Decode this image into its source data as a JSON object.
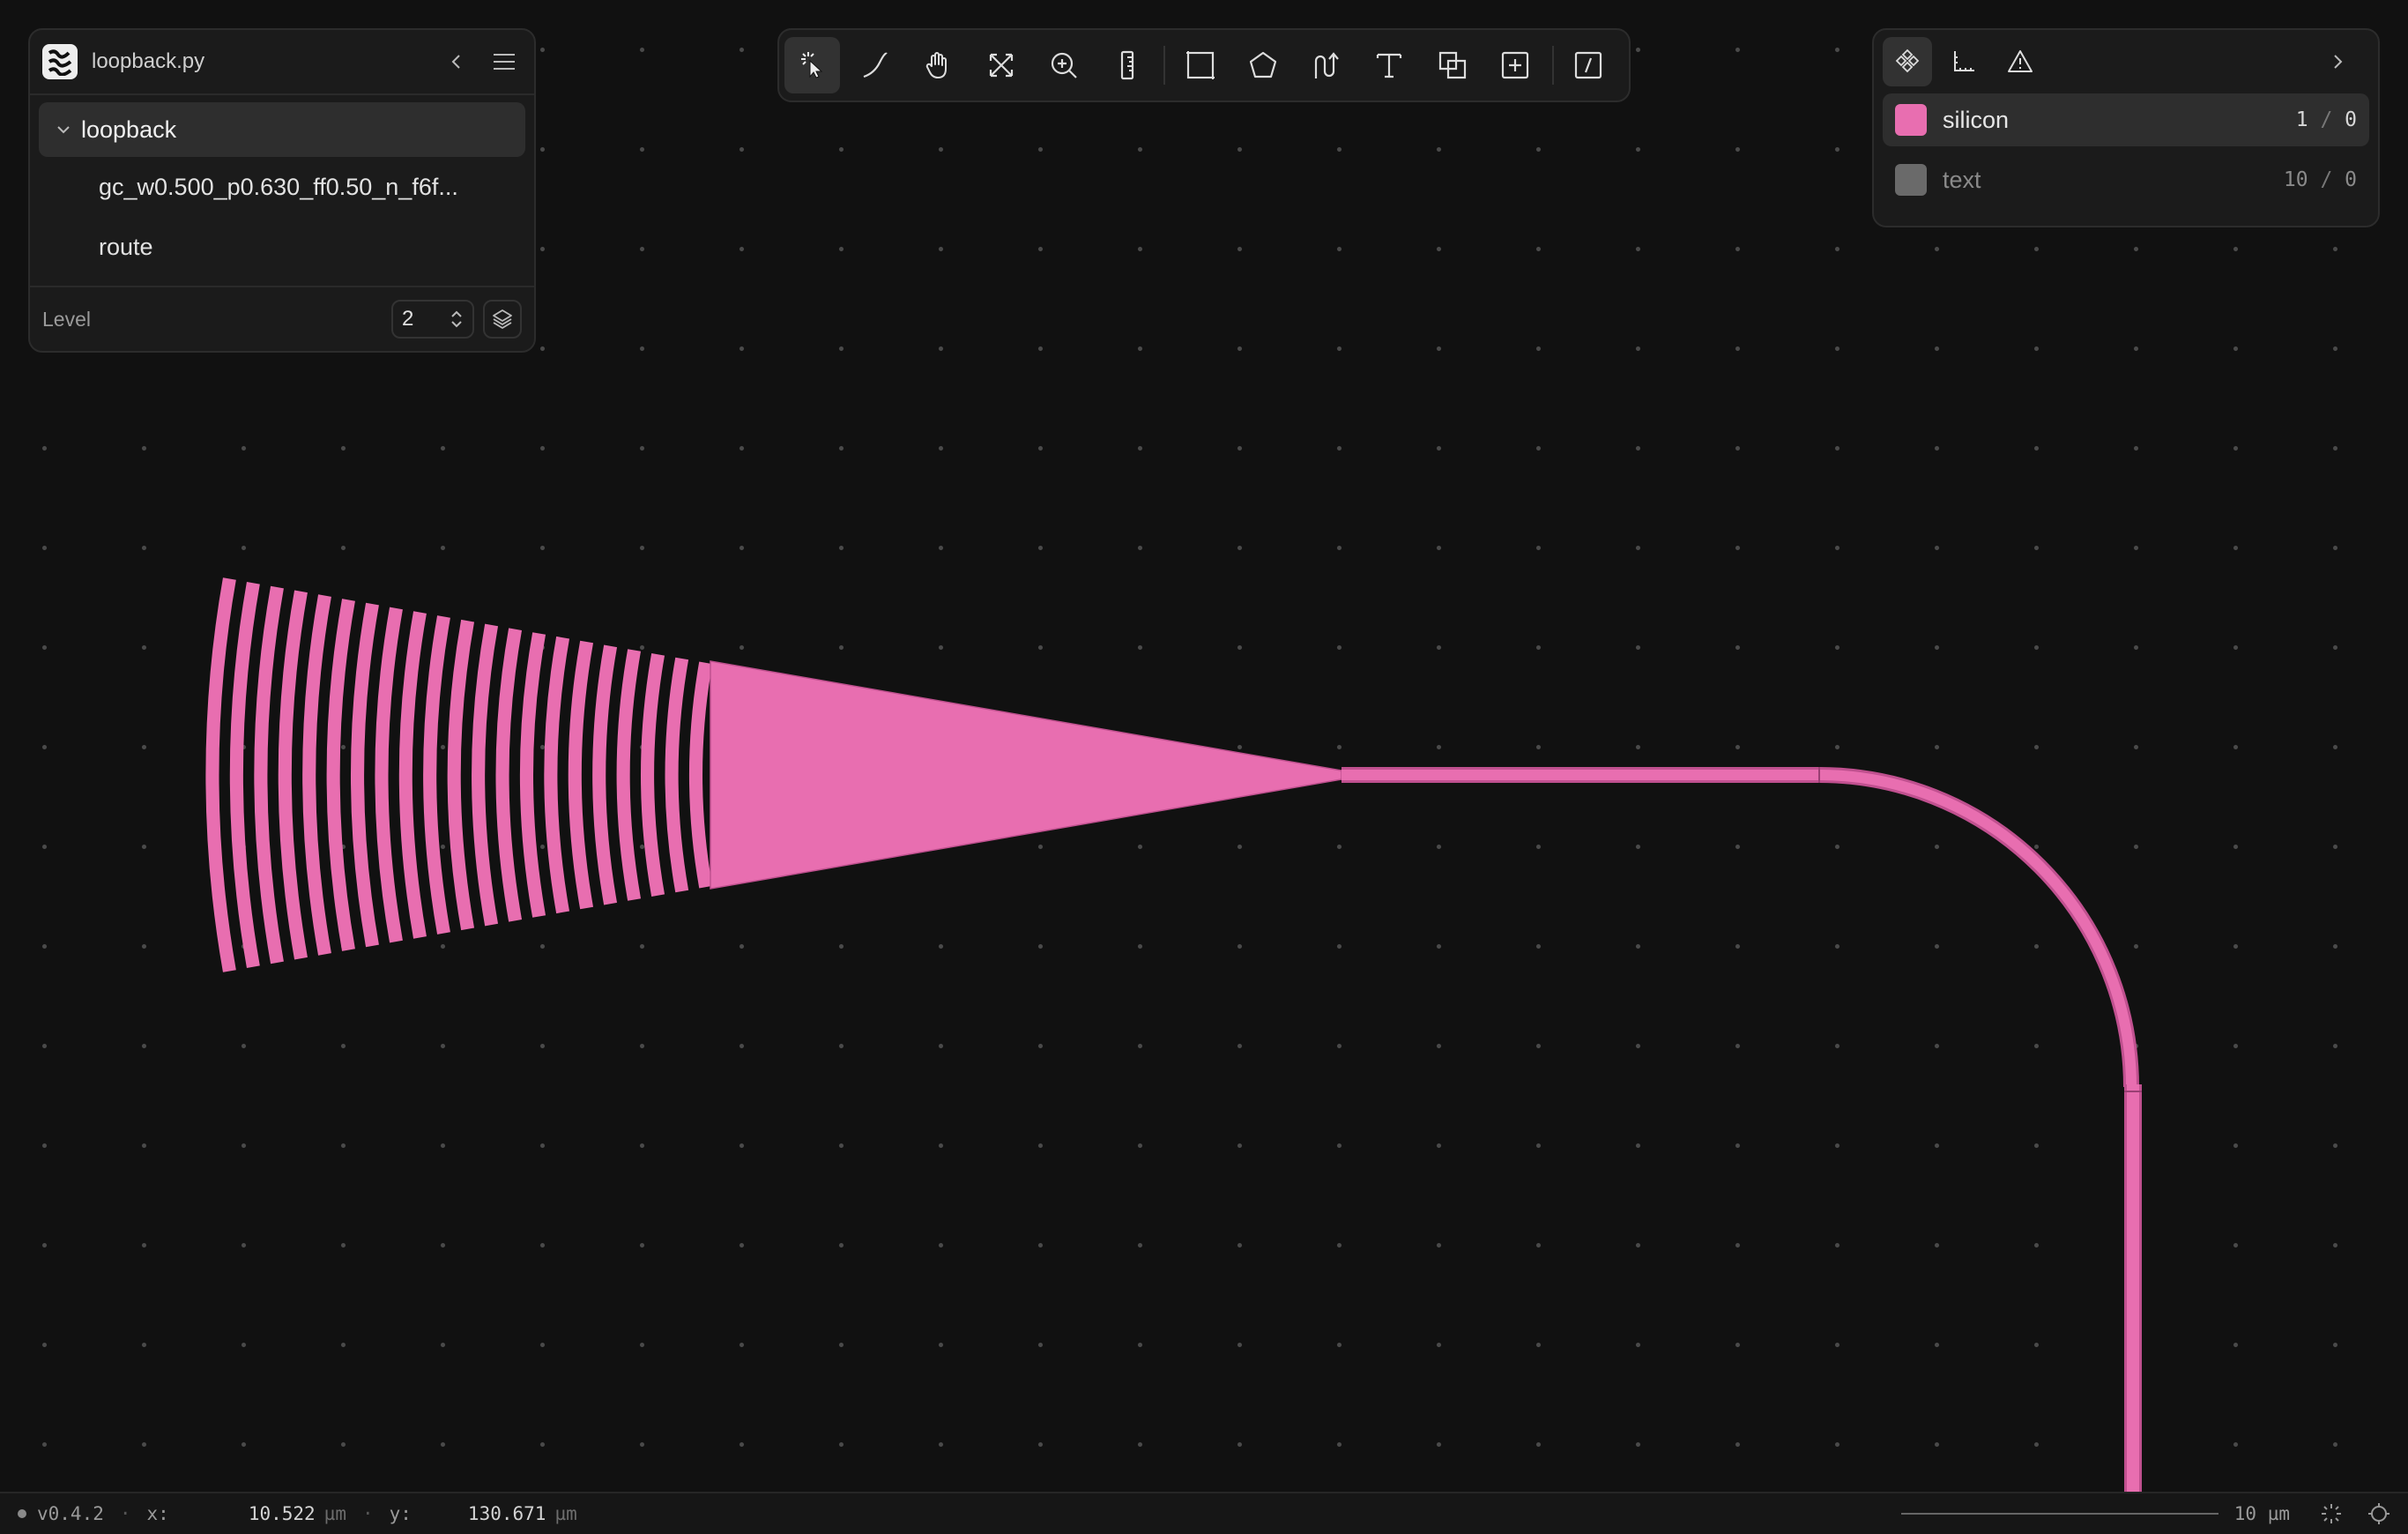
{
  "app": {
    "file_name": "loopback.py",
    "version": "v0.4.2"
  },
  "cell_tree": {
    "root": "loopback",
    "children": [
      "gc_w0.500_p0.630_ff0.50_n_f6f...",
      "route"
    ]
  },
  "level": {
    "label": "Level",
    "value": "2"
  },
  "toolbar": {
    "tools": [
      {
        "name": "select",
        "icon": "select-pointer-icon",
        "active": true
      },
      {
        "name": "path",
        "icon": "path-curve-icon"
      },
      {
        "name": "pan",
        "icon": "hand-icon"
      },
      {
        "name": "fit",
        "icon": "fit-arrows-icon"
      },
      {
        "name": "zoom",
        "icon": "zoom-in-icon"
      },
      {
        "name": "ruler",
        "icon": "ruler-icon"
      },
      {
        "name": "rectangle",
        "icon": "rectangle-icon"
      },
      {
        "name": "polygon",
        "icon": "pentagon-icon"
      },
      {
        "name": "route",
        "icon": "route-icon"
      },
      {
        "name": "text",
        "icon": "text-icon"
      },
      {
        "name": "boolean",
        "icon": "overlap-squares-icon"
      },
      {
        "name": "add-instance",
        "icon": "plus-square-icon"
      },
      {
        "name": "code",
        "icon": "code-slash-icon"
      }
    ]
  },
  "layers": [
    {
      "name": "silicon",
      "count": "1",
      "total": "0",
      "color": "#e86eb0",
      "visible": true
    },
    {
      "name": "text",
      "count": "10",
      "total": "0",
      "color": "#6a6a6a",
      "visible": false
    }
  ],
  "status": {
    "x_label": "x:",
    "x_value": "10.522",
    "y_label": "y:",
    "y_value": "130.671",
    "unit": "µm",
    "scale": "10 µm"
  },
  "colors": {
    "accent": "#e86eb0",
    "background": "#111111"
  }
}
